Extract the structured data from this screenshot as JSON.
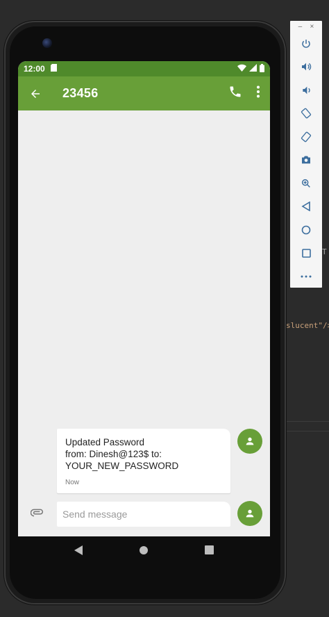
{
  "status_bar": {
    "time": "12:00"
  },
  "app_bar": {
    "title": "23456"
  },
  "message": {
    "text": "Updated Password\nfrom: Dinesh@123$ to:\nYOUR_NEW_PASSWORD",
    "timestamp": "Now"
  },
  "composer": {
    "placeholder": "Send message"
  },
  "ide": {
    "snippet": "slucent\"/>",
    "letter": "T"
  },
  "colors": {
    "primary": "#689f38",
    "status": "#4f8a2b",
    "background": "#eeeeee"
  },
  "toolbar": {
    "window_controls": [
      "–",
      "×"
    ],
    "buttons": [
      "power-icon",
      "volume-up-icon",
      "volume-down-icon",
      "rotate-left-icon",
      "rotate-right-icon",
      "camera-icon",
      "zoom-icon",
      "back-icon",
      "home-icon",
      "overview-icon",
      "more-icon"
    ]
  }
}
